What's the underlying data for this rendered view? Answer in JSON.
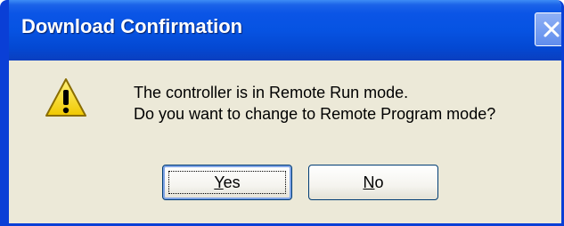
{
  "dialog": {
    "title": "Download Confirmation",
    "close_icon": "close-icon",
    "icon": "warning-icon",
    "message_line1": "The controller is in Remote Run mode.",
    "message_line2": "Do you want to change to Remote Program mode?",
    "buttons": {
      "yes": {
        "mnemonic": "Y",
        "rest": "es"
      },
      "no": {
        "mnemonic": "N",
        "rest": "o"
      }
    },
    "colors": {
      "titlebar": "#0653e2",
      "frame": "#0a3fd6",
      "body": "#ece9d8",
      "warning_yellow": "#f5d400"
    }
  }
}
